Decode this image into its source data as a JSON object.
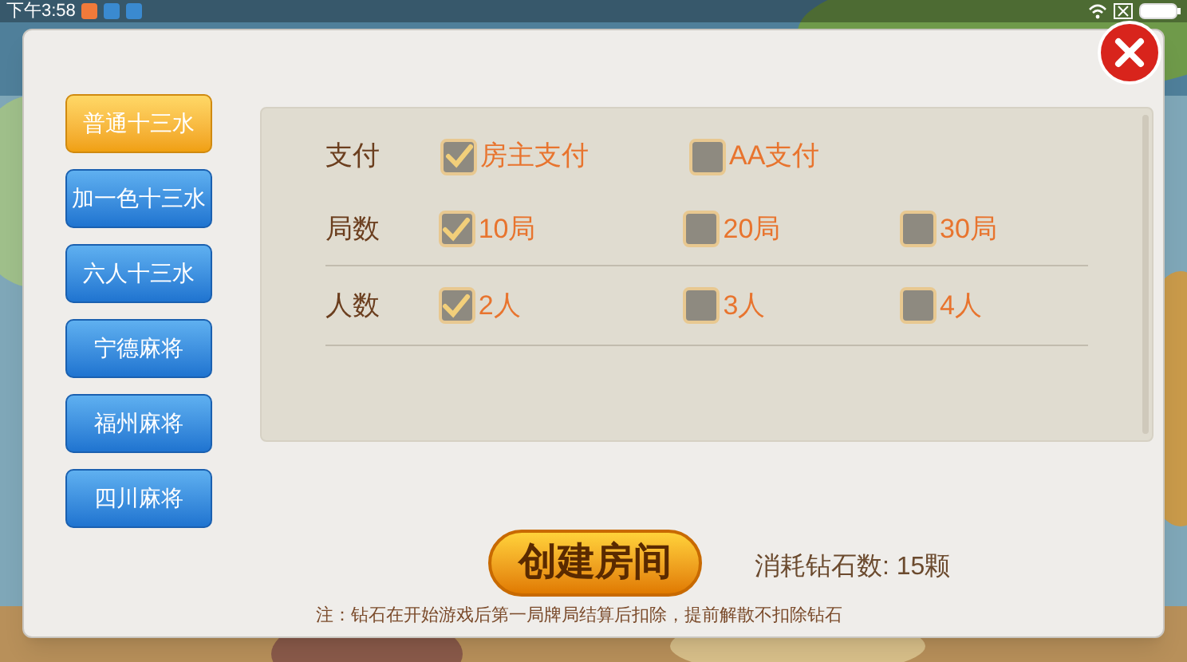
{
  "status_bar": {
    "time": "下午3:58"
  },
  "game_tabs": [
    {
      "label": "普通十三水",
      "selected": true
    },
    {
      "label": "加一色十三水",
      "selected": false
    },
    {
      "label": "六人十三水",
      "selected": false
    },
    {
      "label": "宁德麻将",
      "selected": false
    },
    {
      "label": "福州麻将",
      "selected": false
    },
    {
      "label": "四川麻将",
      "selected": false
    }
  ],
  "settings": [
    {
      "label": "支付",
      "options": [
        {
          "label": "房主支付",
          "checked": true
        },
        {
          "label": "AA支付",
          "checked": false
        }
      ]
    },
    {
      "label": "局数",
      "options": [
        {
          "label": "10局",
          "checked": true
        },
        {
          "label": "20局",
          "checked": false
        },
        {
          "label": "30局",
          "checked": false
        }
      ]
    },
    {
      "label": "人数",
      "options": [
        {
          "label": "2人",
          "checked": true
        },
        {
          "label": "3人",
          "checked": false
        },
        {
          "label": "4人",
          "checked": false
        }
      ]
    }
  ],
  "create_button": "创建房间",
  "cost": "消耗钻石数: 15颗",
  "note": "注：钻石在开始游戏后第一局牌局结算后扣除，提前解散不扣除钻石"
}
